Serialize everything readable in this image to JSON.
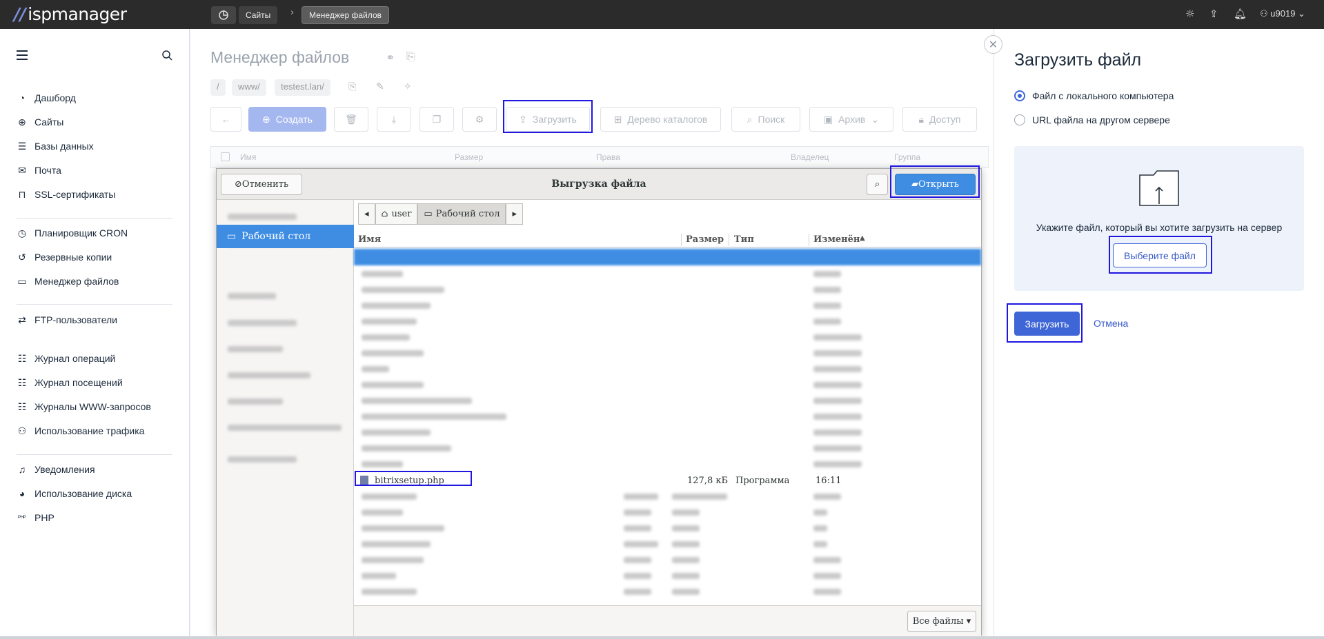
{
  "topbar": {
    "logo": "ispmanager",
    "breadcrumbs": [
      "Сайты",
      "Менеджер файлов"
    ],
    "user": "u9019"
  },
  "sidebar": {
    "items": [
      {
        "label": "Дашборд",
        "icon": "dashboard-icon"
      },
      {
        "label": "Сайты",
        "icon": "globe-icon"
      },
      {
        "label": "Базы данных",
        "icon": "database-icon"
      },
      {
        "label": "Почта",
        "icon": "mail-icon"
      },
      {
        "label": "SSL-сертификаты",
        "icon": "lock-icon"
      },
      {
        "label": "Планировщик CRON",
        "icon": "clock-icon"
      },
      {
        "label": "Резервные копии",
        "icon": "backup-icon"
      },
      {
        "label": "Менеджер файлов",
        "icon": "folder-icon"
      },
      {
        "label": "FTP-пользователи",
        "icon": "ftp-icon"
      },
      {
        "label": "Журнал операций",
        "icon": "journal-icon"
      },
      {
        "label": "Журнал посещений",
        "icon": "journal-icon"
      },
      {
        "label": "Журналы WWW-запросов",
        "icon": "journal-icon"
      },
      {
        "label": "Использование трафика",
        "icon": "traffic-icon"
      },
      {
        "label": "Уведомления",
        "icon": "bell-icon"
      },
      {
        "label": "Использование диска",
        "icon": "disk-icon"
      },
      {
        "label": "PHP",
        "icon": "php-icon"
      }
    ]
  },
  "main": {
    "title": "Менеджер файлов",
    "path": [
      "/",
      "www/",
      "testest.lan/"
    ],
    "toolbar": {
      "create": "Создать",
      "upload": "Загрузить",
      "tree": "Дерево каталогов",
      "search": "Поиск",
      "archive": "Архив",
      "access": "Доступ"
    },
    "columns": [
      "Имя",
      "Размер",
      "Права",
      "Владелец",
      "Группа"
    ]
  },
  "dialog": {
    "title": "Выгрузка файла",
    "cancel": "Отменить",
    "open": "Открыть",
    "place_selected": "Рабочий стол",
    "path": [
      "user",
      "Рабочий стол"
    ],
    "columns": [
      "Имя",
      "Размер",
      "Тип",
      "Изменён"
    ],
    "highlighted_file": {
      "name": "bitrixsetup.php",
      "size": "127,8 кБ",
      "type": "Программа",
      "modified": "16:11"
    },
    "filter": "Все файлы"
  },
  "upload_panel": {
    "title": "Загрузить файл",
    "option_local": "Файл с локального компьютера",
    "option_url": "URL файла на другом сервере",
    "hint": "Укажите файл, который вы хотите загрузить на сервер",
    "choose": "Выберите файл",
    "submit": "Загрузить",
    "cancel": "Отмена"
  }
}
